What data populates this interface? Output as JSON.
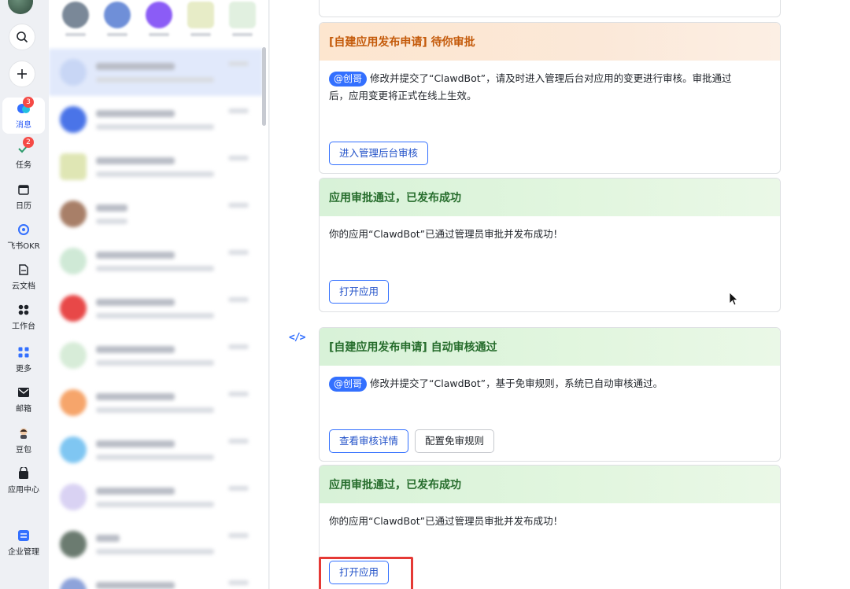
{
  "nav": {
    "items": [
      {
        "label": "消息",
        "badge": "3",
        "icon": "message-icon",
        "active": true
      },
      {
        "label": "任务",
        "badge": "2",
        "icon": "task-icon"
      },
      {
        "label": "日历",
        "icon": "calendar-icon"
      },
      {
        "label": "飞书OKR",
        "icon": "okr-icon"
      },
      {
        "label": "云文档",
        "icon": "docs-icon"
      },
      {
        "label": "工作台",
        "icon": "workplace-icon"
      },
      {
        "label": "更多",
        "icon": "more-icon"
      },
      {
        "label": "邮箱",
        "icon": "mail-icon"
      },
      {
        "label": "豆包",
        "icon": "doubao-icon"
      },
      {
        "label": "应用中心",
        "icon": "app-center-icon"
      },
      {
        "label": "企业管理",
        "icon": "admin-icon"
      }
    ],
    "search_icon": "search-icon",
    "add_icon": "plus-icon"
  },
  "cards": [
    {
      "title": "[自建应用发布申请] 待你审批",
      "mention": "@创哥",
      "body_before": "修改并提交了“ClawdBot”，请及时进入管理后台对应用的变更进行审核。审批通过",
      "body_after": "后，应用变更将正式在线上生效。",
      "buttons": [
        "进入管理后台审核"
      ]
    },
    {
      "title": "应用审批通过，已发布成功",
      "body": "你的应用“ClawdBot”已通过管理员审批并发布成功！",
      "buttons": [
        "打开应用"
      ]
    },
    {
      "title": "[自建应用发布申请] 自动审核通过",
      "mention": "@创哥",
      "body_before": "修改并提交了“ClawdBot”，基于免审规则，系统已自动审核通过。",
      "buttons": [
        "查看审核详情",
        "配置免审规则"
      ]
    },
    {
      "title": "应用审批通过，已发布成功",
      "body": "你的应用“ClawdBot”已通过管理员审批并发布成功！",
      "buttons": [
        "打开应用"
      ]
    }
  ],
  "bot_avatar_text": "</>",
  "colors": {
    "accent": "#3370ff",
    "pending_header": "#fde6cf",
    "success_header": "#d8f2d8",
    "highlight": "#e53935",
    "badge": "#f54a45"
  }
}
